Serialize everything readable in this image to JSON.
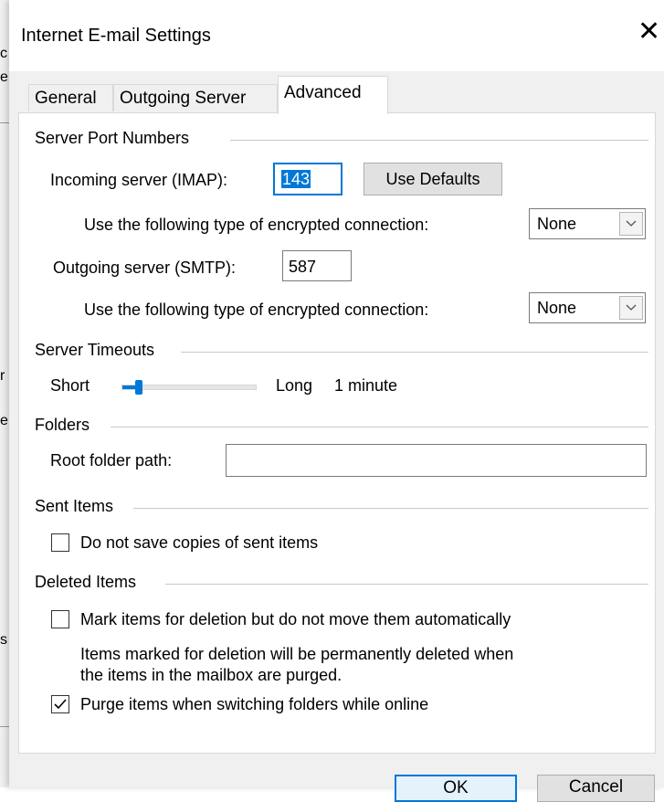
{
  "background_window": {
    "fragments": [
      "c",
      "e",
      "r",
      "e",
      "s"
    ]
  },
  "dialog": {
    "title": "Internet E-mail Settings",
    "close_glyph": "✕"
  },
  "tabs": [
    {
      "label": "General",
      "active": false
    },
    {
      "label": "Outgoing Server",
      "active": false
    },
    {
      "label": "Advanced",
      "active": true
    }
  ],
  "server_ports": {
    "group_label": "Server Port Numbers",
    "incoming_label": "Incoming server (IMAP):",
    "incoming_value": "143",
    "use_defaults_label": "Use Defaults",
    "incoming_encryption_label": "Use the following type of encrypted connection:",
    "incoming_encryption_value": "None",
    "outgoing_label": "Outgoing server (SMTP):",
    "outgoing_value": "587",
    "outgoing_encryption_label": "Use the following type of encrypted connection:",
    "outgoing_encryption_value": "None"
  },
  "server_timeouts": {
    "group_label": "Server Timeouts",
    "short_label": "Short",
    "long_label": "Long",
    "value_label": "1 minute",
    "slider_fraction": 0.1
  },
  "folders": {
    "group_label": "Folders",
    "root_path_label": "Root folder path:",
    "root_path_value": ""
  },
  "sent_items": {
    "group_label": "Sent Items",
    "no_save_label": "Do not save copies of sent items",
    "no_save_checked": false
  },
  "deleted_items": {
    "group_label": "Deleted Items",
    "mark_label": "Mark items for deletion but do not move them automatically",
    "mark_checked": false,
    "note_line1": "Items marked for deletion will be permanently deleted when",
    "note_line2": "the items in the mailbox are purged.",
    "purge_label": "Purge items when switching folders while online",
    "purge_checked": true
  },
  "footer": {
    "ok_label": "OK",
    "cancel_label": "Cancel"
  },
  "colors": {
    "accent": "#0078d7",
    "dialog_bg": "#f0f0f0",
    "panel_bg": "#ffffff"
  }
}
